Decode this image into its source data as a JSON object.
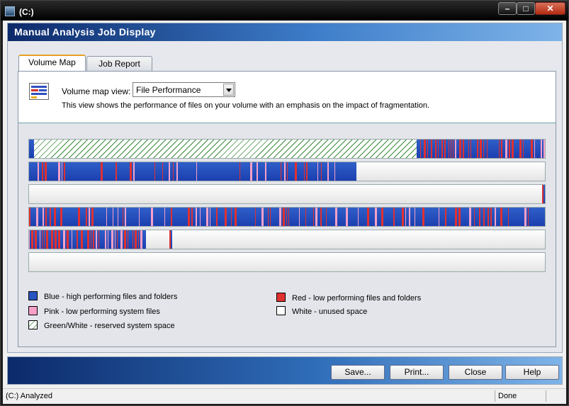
{
  "window": {
    "title": "(C:)"
  },
  "header": {
    "title": "Manual Analysis Job Display"
  },
  "tabs": [
    {
      "label": "Volume Map"
    },
    {
      "label": "Job Report"
    }
  ],
  "view": {
    "label": "Volume map view:",
    "selected": "File Performance",
    "description": "This view shows the performance of files on your volume with an emphasis on the impact of fragmentation."
  },
  "colors": {
    "blue": "#2a55c0",
    "red": "#e03030",
    "pink": "#f8a0c8",
    "white": "#ffffff",
    "green": "#3a8a3a"
  },
  "legend": [
    {
      "label": "Blue - high performing files and folders",
      "color": "#2a55c0"
    },
    {
      "label": "Red - low performing files and folders",
      "color": "#e03030"
    },
    {
      "label": "Pink - low performing system files",
      "color": "#f8a0c8"
    },
    {
      "label": "White - unused space",
      "color": "#ffffff"
    },
    {
      "label": "Green/White - reserved system space",
      "color": "green-white"
    }
  ],
  "buttons": {
    "save": "Save...",
    "print": "Print...",
    "close": "Close",
    "help": "Help"
  },
  "status": {
    "left": "(C:) Analyzed",
    "right": "Done"
  }
}
